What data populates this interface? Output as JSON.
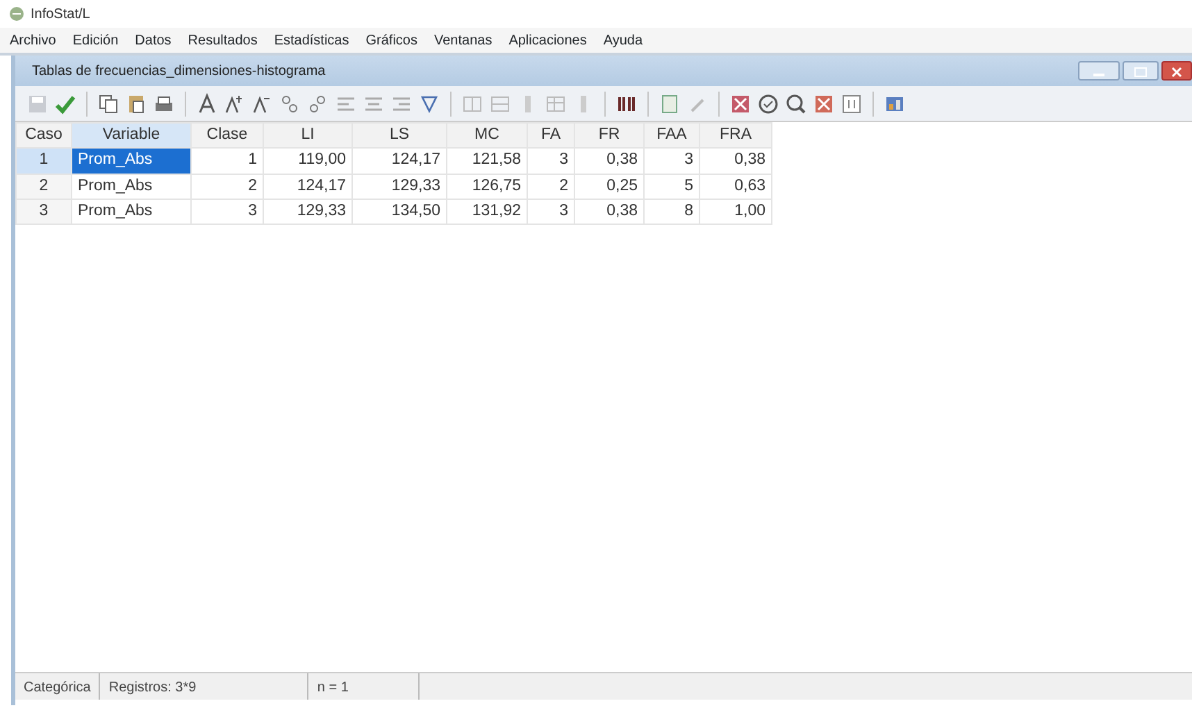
{
  "window": {
    "title": "InfoStat/L"
  },
  "menu": [
    "Archivo",
    "Edición",
    "Datos",
    "Resultados",
    "Estadísticas",
    "Gráficos",
    "Ventanas",
    "Aplicaciones",
    "Ayuda"
  ],
  "child_window": {
    "title": "Tablas de frecuencias_dimensiones-histograma"
  },
  "table": {
    "columns": [
      {
        "label": "Caso",
        "selected": false
      },
      {
        "label": "Variable",
        "selected": true
      },
      {
        "label": "Clase",
        "selected": false
      },
      {
        "label": "LI",
        "selected": false
      },
      {
        "label": "LS",
        "selected": false
      },
      {
        "label": "MC",
        "selected": false
      },
      {
        "label": "FA",
        "selected": false
      },
      {
        "label": "FR",
        "selected": false
      },
      {
        "label": "FAA",
        "selected": false
      },
      {
        "label": "FRA",
        "selected": false
      }
    ],
    "rows": [
      {
        "selected": true,
        "cells": [
          "1",
          "Prom_Abs",
          "1",
          "119,00",
          "124,17",
          "121,58",
          "3",
          "0,38",
          "3",
          "0,38"
        ]
      },
      {
        "selected": false,
        "cells": [
          "2",
          "Prom_Abs",
          "2",
          "124,17",
          "129,33",
          "126,75",
          "2",
          "0,25",
          "5",
          "0,63"
        ]
      },
      {
        "selected": false,
        "cells": [
          "3",
          "Prom_Abs",
          "3",
          "129,33",
          "134,50",
          "131,92",
          "3",
          "0,38",
          "8",
          "1,00"
        ]
      }
    ]
  },
  "status_bar": [
    "Categórica",
    "Registros: 3*9",
    "n = 1"
  ]
}
